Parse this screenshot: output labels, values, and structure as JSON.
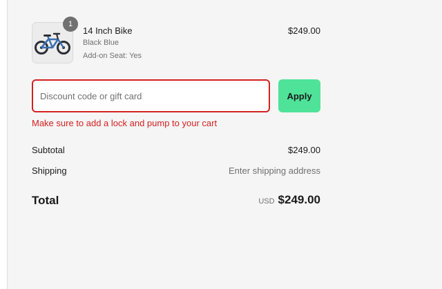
{
  "product": {
    "quantity": "1",
    "name": "14 Inch Bike",
    "variant": "Black Blue",
    "addon": "Add-on Seat: Yes",
    "price": "$249.00",
    "image_icon": "bike-icon"
  },
  "discount": {
    "placeholder": "Discount code or gift card",
    "value": "",
    "apply_label": "Apply",
    "error": "Make sure to add a lock and pump to your cart"
  },
  "summary": {
    "subtotal_label": "Subtotal",
    "subtotal_value": "$249.00",
    "shipping_label": "Shipping",
    "shipping_value": "Enter shipping address",
    "total_label": "Total",
    "total_currency": "USD",
    "total_value": "$249.00"
  },
  "colors": {
    "error": "#d32020",
    "apply_button": "#4fe39a",
    "panel_background": "#f5f5f5"
  }
}
